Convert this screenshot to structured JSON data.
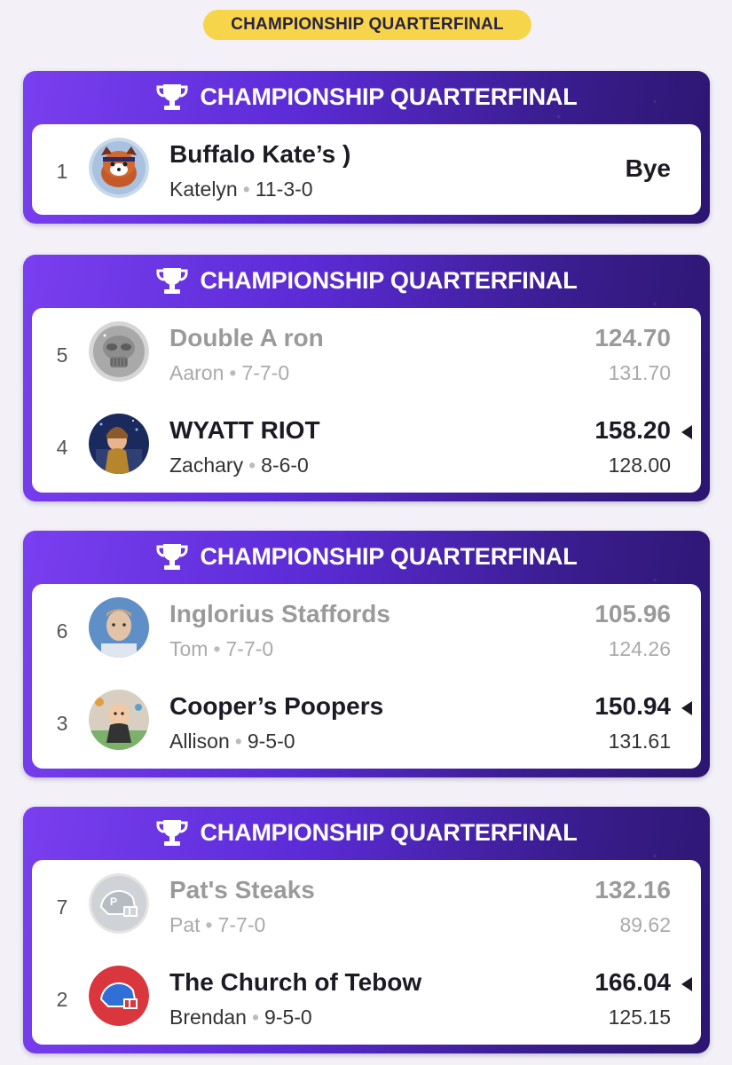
{
  "round_label": "CHAMPIONSHIP QUARTERFINAL",
  "matchups": [
    {
      "header": "CHAMPIONSHIP QUARTERFINAL",
      "teams": [
        {
          "seed": "1",
          "name": "Buffalo Kate’s )",
          "manager": "Katelyn",
          "record": "11-3-0",
          "result": "Bye"
        }
      ]
    },
    {
      "header": "CHAMPIONSHIP QUARTERFINAL",
      "teams": [
        {
          "seed": "5",
          "name": "Double A ron",
          "manager": "Aaron",
          "record": "7-7-0",
          "score": "124.70",
          "projected": "131.70"
        },
        {
          "seed": "4",
          "name": "WYATT RIOT",
          "manager": "Zachary",
          "record": "8-6-0",
          "score": "158.20",
          "projected": "128.00"
        }
      ]
    },
    {
      "header": "CHAMPIONSHIP QUARTERFINAL",
      "teams": [
        {
          "seed": "6",
          "name": "Inglorius Staffords",
          "manager": "Tom",
          "record": "7-7-0",
          "score": "105.96",
          "projected": "124.26"
        },
        {
          "seed": "3",
          "name": "Cooper’s Poopers",
          "manager": "Allison",
          "record": "9-5-0",
          "score": "150.94",
          "projected": "131.61"
        }
      ]
    },
    {
      "header": "CHAMPIONSHIP QUARTERFINAL",
      "teams": [
        {
          "seed": "7",
          "name": "Pat's Steaks",
          "manager": "Pat",
          "record": "7-7-0",
          "score": "132.16",
          "projected": "89.62"
        },
        {
          "seed": "2",
          "name": "The Church of Tebow",
          "manager": "Brendan",
          "record": "9-5-0",
          "score": "166.04",
          "projected": "125.15"
        }
      ]
    }
  ],
  "colors": {
    "pill_bg": "#f7d54a",
    "header_gradient_start": "#7a3ff0",
    "header_gradient_end": "#2c1670",
    "winner_text": "#1d1a24",
    "loser_text": "#9a9a9a"
  },
  "icons": {
    "header": "trophy-icon",
    "winner_marker": "winner-arrow-icon"
  }
}
